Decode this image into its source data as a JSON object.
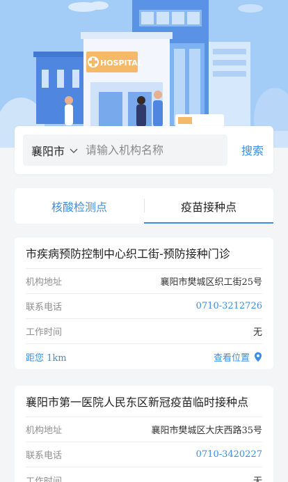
{
  "hero": {
    "sign_text": "HOSPITAL"
  },
  "search": {
    "city": "襄阳市",
    "placeholder": "请输入机构名称",
    "button_label": "搜索"
  },
  "tabs": [
    {
      "label": "核酸检测点",
      "active": false
    },
    {
      "label": "疫苗接种点",
      "active": true
    }
  ],
  "labels": {
    "address": "机构地址",
    "phone": "联系电话",
    "hours": "工作时间",
    "view_location": "查看位置"
  },
  "sites": [
    {
      "name": "市疾病预防控制中心织工街-预防接种门诊",
      "address": "襄阳市樊城区织工街25号",
      "phone": "0710-3212726",
      "hours": "无",
      "distance": "距您  1km"
    },
    {
      "name": "襄阳市第一医院人民东区新冠疫苗临时接种点",
      "address": "襄阳市樊城区大庆西路35号",
      "phone": "0710-3420227",
      "hours": "无"
    }
  ],
  "colors": {
    "accent": "#3a8ee6",
    "hero_bg": "#9cc8f6"
  }
}
